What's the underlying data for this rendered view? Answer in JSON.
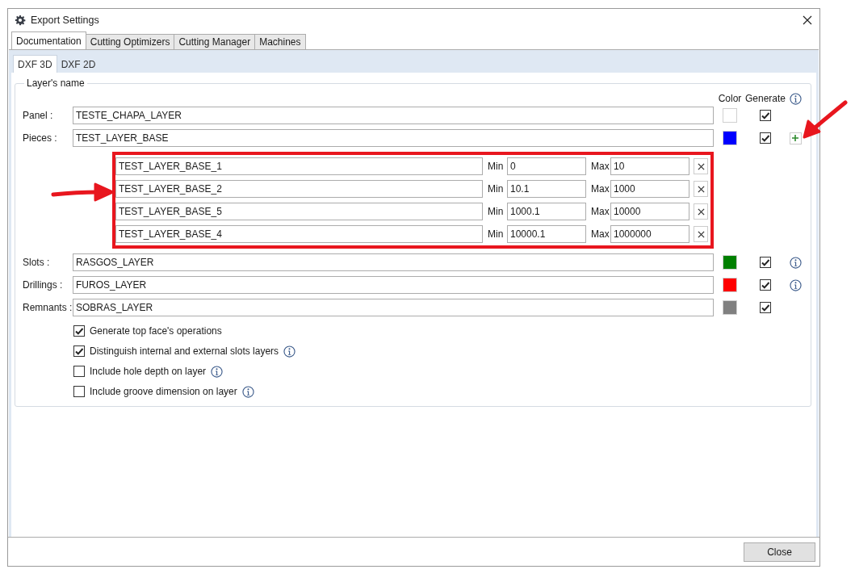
{
  "window": {
    "title": "Export Settings"
  },
  "tabs": [
    {
      "label": "Documentation",
      "selected": true
    },
    {
      "label": "Cutting Optimizers",
      "selected": false
    },
    {
      "label": "Cutting Manager",
      "selected": false
    },
    {
      "label": "Machines",
      "selected": false
    }
  ],
  "subtabs": [
    {
      "label": "DXF 3D",
      "selected": true
    },
    {
      "label": "DXF 2D",
      "selected": false
    }
  ],
  "group": {
    "title": "Layer's name",
    "headers": {
      "color_label": "Color",
      "generate_label": "Generate"
    },
    "rows": [
      {
        "label": "Panel :",
        "value": "TESTE_CHAPA_LAYER",
        "color": "#ffffff",
        "generate": true,
        "kind": "plain"
      },
      {
        "label": "Pieces :",
        "value": "TEST_LAYER_BASE",
        "color": "#0000ff",
        "generate": true,
        "kind": "add",
        "sublayers": [
          {
            "name": "TEST_LAYER_BASE_1",
            "min_label": "Min",
            "min": "0",
            "max_label": "Max",
            "max": "10"
          },
          {
            "name": "TEST_LAYER_BASE_2",
            "min_label": "Min",
            "min": "10.1",
            "max_label": "Max",
            "max": "1000"
          },
          {
            "name": "TEST_LAYER_BASE_5",
            "min_label": "Min",
            "min": "1000.1",
            "max_label": "Max",
            "max": "10000"
          },
          {
            "name": "TEST_LAYER_BASE_4",
            "min_label": "Min",
            "min": "10000.1",
            "max_label": "Max",
            "max": "1000000"
          }
        ]
      },
      {
        "label": "Slots :",
        "value": "RASGOS_LAYER",
        "color": "#008000",
        "generate": true,
        "kind": "info"
      },
      {
        "label": "Drillings :",
        "value": "FUROS_LAYER",
        "color": "#ff0000",
        "generate": true,
        "kind": "info"
      },
      {
        "label": "Remnants :",
        "value": "SOBRAS_LAYER",
        "color": "#808080",
        "generate": true,
        "kind": "plain"
      }
    ],
    "options": [
      {
        "label": "Generate top face's operations",
        "checked": true,
        "kind": "plain"
      },
      {
        "label": "Distinguish internal and external slots layers",
        "checked": true,
        "kind": "info"
      },
      {
        "label": "Include hole depth on layer",
        "checked": false,
        "kind": "info"
      },
      {
        "label": "Include groove dimension on layer",
        "checked": false,
        "kind": "info"
      }
    ]
  },
  "buttons": [
    {
      "label": "Close"
    }
  ]
}
